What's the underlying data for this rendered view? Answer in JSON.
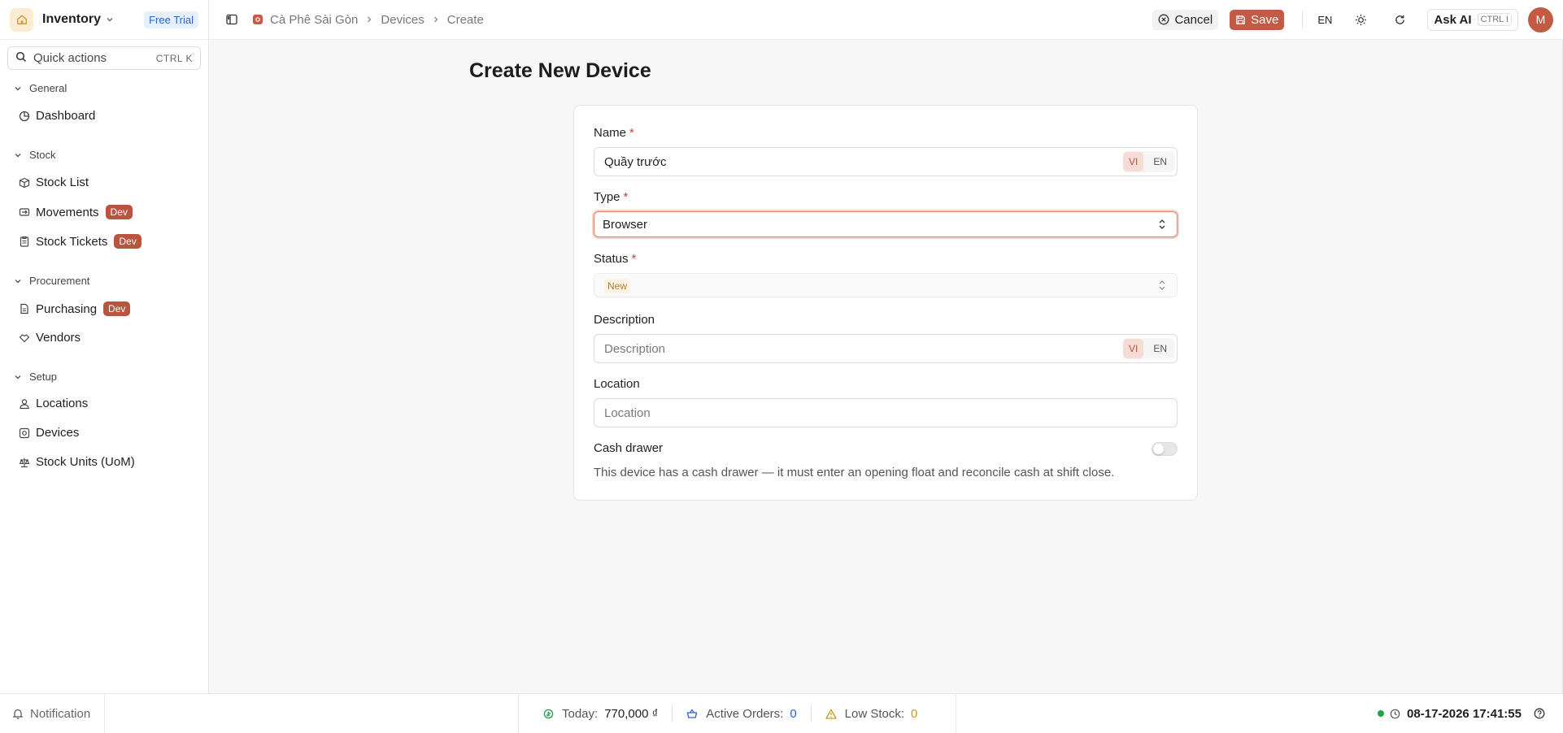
{
  "app": {
    "name": "Inventory",
    "plan_badge": "Free Trial"
  },
  "quick_actions": {
    "label": "Quick actions",
    "shortcut": "CTRL K"
  },
  "sidebar": {
    "groups": [
      {
        "title": "General",
        "items": [
          {
            "label": "Dashboard",
            "icon": "dashboard-icon"
          }
        ]
      },
      {
        "title": "Stock",
        "items": [
          {
            "label": "Stock List",
            "icon": "boxes-icon"
          },
          {
            "label": "Movements",
            "icon": "movements-icon",
            "badge": "Dev"
          },
          {
            "label": "Stock Tickets",
            "icon": "clipboard-icon",
            "badge": "Dev"
          }
        ]
      },
      {
        "title": "Procurement",
        "items": [
          {
            "label": "Purchasing",
            "icon": "document-icon",
            "badge": "Dev"
          },
          {
            "label": "Vendors",
            "icon": "handshake-icon"
          }
        ]
      },
      {
        "title": "Setup",
        "items": [
          {
            "label": "Locations",
            "icon": "users-icon"
          },
          {
            "label": "Devices",
            "icon": "device-icon"
          },
          {
            "label": "Stock Units (UoM)",
            "icon": "scale-icon"
          }
        ]
      }
    ]
  },
  "breadcrumb": {
    "org": "Cà Phê Sài Gòn",
    "section": "Devices",
    "page": "Create"
  },
  "toolbar": {
    "cancel_label": "Cancel",
    "save_label": "Save",
    "language": "EN",
    "ask_ai_label": "Ask AI",
    "ask_ai_shortcut": "CTRL I",
    "avatar_initial": "M"
  },
  "form": {
    "title": "Create New Device",
    "name_label": "Name",
    "name_value": "Quầy trước",
    "type_label": "Type",
    "type_value": "Browser",
    "status_label": "Status",
    "status_value": "New",
    "description_label": "Description",
    "description_placeholder": "Description",
    "location_label": "Location",
    "location_placeholder": "Location",
    "cash_drawer_label": "Cash drawer",
    "cash_drawer_enabled": false,
    "cash_drawer_hint": "This device has a cash drawer — it must enter an opening float and reconcile cash at shift close.",
    "lang_vi": "VI",
    "lang_en": "EN",
    "required_mark": "*"
  },
  "statusbar": {
    "notification_label": "Notification",
    "today_label": "Today:",
    "today_value": "770,000 ₫",
    "orders_label": "Active Orders:",
    "orders_value": "0",
    "low_stock_label": "Low Stock:",
    "low_stock_value": "0",
    "datetime": "08-17-2026 17:41:55"
  },
  "colors": {
    "accent": "#c35a45",
    "trial_text": "#2a66c8",
    "orders_value": "#2a66c8",
    "low_stock_value": "#c99a1e",
    "online": "#1fa34a"
  }
}
